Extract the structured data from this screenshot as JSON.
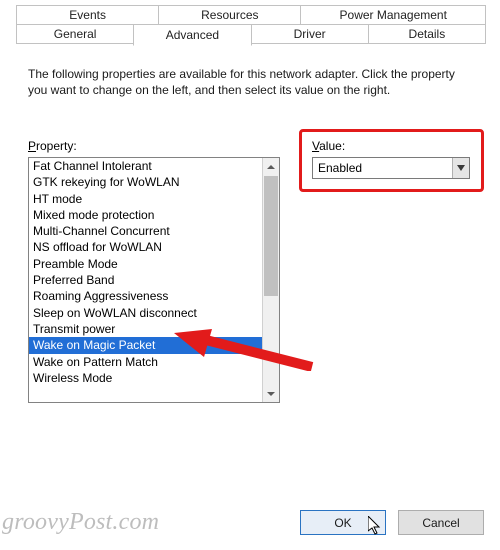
{
  "tabs_row1": [
    "Events",
    "Resources",
    "Power Management"
  ],
  "tabs_row2": [
    "General",
    "Advanced",
    "Driver",
    "Details"
  ],
  "active_tab": "Advanced",
  "description": "The following properties are available for this network adapter. Click the property you want to change on the left, and then select its value on the right.",
  "property_label": "Property:",
  "value_label": "Value:",
  "properties": [
    "Fat Channel Intolerant",
    "GTK rekeying for WoWLAN",
    "HT mode",
    "Mixed mode protection",
    "Multi-Channel Concurrent",
    "NS offload for WoWLAN",
    "Preamble Mode",
    "Preferred Band",
    "Roaming Aggressiveness",
    "Sleep on WoWLAN disconnect",
    "Transmit power",
    "Wake on Magic Packet",
    "Wake on Pattern Match",
    "Wireless Mode"
  ],
  "selected_property": "Wake on Magic Packet",
  "value_selected": "Enabled",
  "buttons": {
    "ok": "OK",
    "cancel": "Cancel"
  },
  "watermark": "groovyPost.com"
}
